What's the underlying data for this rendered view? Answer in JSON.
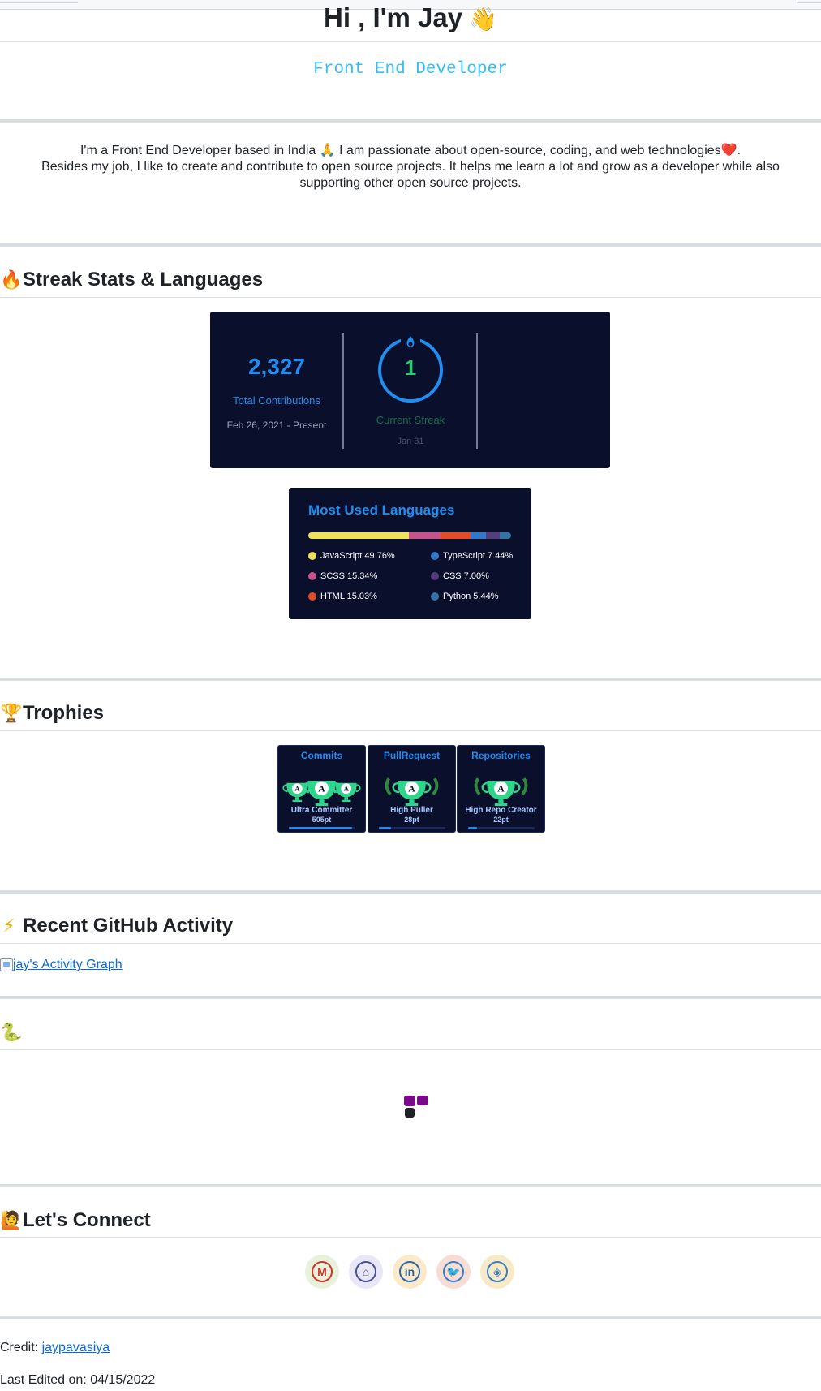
{
  "header": {
    "greeting": "Hi , I'm Jay",
    "wave_emoji": "👋",
    "role": "Front End Developer"
  },
  "about": {
    "line1_pre": "I'm a Front End Developer based in India",
    "line1_emoji1": "🙏",
    "line1_mid": " I am passionate about open-source, coding, and web technologies",
    "line1_emoji2": "❤️",
    "line1_end": ".",
    "line2": "Besides my job, I like to create and contribute to open source projects. It helps me learn a lot and grow as a developer while also supporting other open source projects."
  },
  "sections": {
    "streak": {
      "icon": "🔥",
      "title": "Streak Stats & Languages"
    },
    "trophies": {
      "icon": "🏆",
      "title": "Trophies"
    },
    "activity": {
      "icon": "⚡",
      "title": "Recent GitHub Activity"
    },
    "snake": {
      "icon": "🐍"
    },
    "connect": {
      "icon": "🙋",
      "title": "Let's Connect"
    }
  },
  "streak_card": {
    "total": "2,327",
    "total_label": "Total Contributions",
    "total_range": "Feb 26, 2021 - Present",
    "current": "1",
    "current_label": "Current Streak",
    "current_range": "Jan 31"
  },
  "languages_card": {
    "title": "Most Used Languages",
    "items": [
      {
        "label": "JavaScript 49.76%",
        "name": "JavaScript",
        "percent": 49.76,
        "color": "#f1e05a"
      },
      {
        "label": "SCSS 15.34%",
        "name": "SCSS",
        "percent": 15.34,
        "color": "#c6538c"
      },
      {
        "label": "HTML 15.03%",
        "name": "HTML",
        "percent": 15.03,
        "color": "#e34c26"
      },
      {
        "label": "TypeScript 7.44%",
        "name": "TypeScript",
        "percent": 7.44,
        "color": "#3178c6"
      },
      {
        "label": "CSS 7.00%",
        "name": "CSS",
        "percent": 7.0,
        "color": "#563d7c"
      },
      {
        "label": "Python 5.44%",
        "name": "Python",
        "percent": 5.44,
        "color": "#3572a5"
      }
    ]
  },
  "trophies": [
    {
      "title": "Commits",
      "rank": "Ultra Committer",
      "points": "505pt",
      "grade": "A",
      "progress": 0.95
    },
    {
      "title": "PullRequest",
      "rank": "High Puller",
      "points": "28pt",
      "grade": "A",
      "progress": 0.18
    },
    {
      "title": "Repositories",
      "rank": "High Repo Creator",
      "points": "22pt",
      "grade": "A",
      "progress": 0.14
    }
  ],
  "activity": {
    "link_text": "jay's Activity Graph"
  },
  "socials": [
    {
      "name": "gmail",
      "icon": "gmail-icon",
      "glyph": "M",
      "color": "#d93025",
      "bg": "#e8f1dc"
    },
    {
      "name": "github",
      "icon": "github-icon",
      "glyph": "⌂",
      "color": "#4b4f9a",
      "bg": "#e7e7f5"
    },
    {
      "name": "linkedin",
      "icon": "linkedin-icon",
      "glyph": "in",
      "color": "#2c66a8",
      "bg": "#fbe9c9"
    },
    {
      "name": "twitter",
      "icon": "twitter-icon",
      "glyph": "🐦",
      "color": "#3a7dc2",
      "bg": "#f8dcd6"
    },
    {
      "name": "portfolio",
      "icon": "portfolio-icon",
      "glyph": "◈",
      "color": "#3a7dc2",
      "bg": "#f8eac6"
    }
  ],
  "footer": {
    "credit_label": "Credit: ",
    "credit_link": "jaypavasiya",
    "edited": "Last Edited on: 04/15/2022"
  },
  "colors": {
    "accent": "#1f8ef0",
    "card_bg": "#0a0f2c",
    "streak_green": "#2ecc71",
    "role_text": "#36bcf7",
    "link": "#0969da"
  }
}
